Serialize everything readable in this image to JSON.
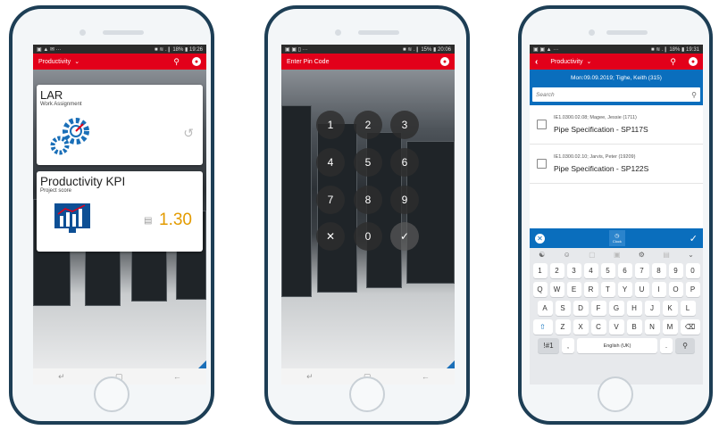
{
  "phone1": {
    "status_left": "▣ ▲ ✉ ···",
    "status_right": "■ ≋ .❙ 18% ▮ 19:26",
    "appbar_title": "Productivity",
    "tile_lar": {
      "title": "LAR",
      "subtitle": "Work Assignment"
    },
    "tile_kpi": {
      "title": "Productivity KPI",
      "subtitle": "Project score",
      "value": "1.30"
    }
  },
  "phone2": {
    "status_left": "▣ ▣ ▯ ···",
    "status_right": "■ ≋ .❙ 15% ▮ 20:06",
    "appbar_title": "Enter Pin Code",
    "keys": [
      "1",
      "2",
      "3",
      "4",
      "5",
      "6",
      "7",
      "8",
      "9",
      "✕",
      "0",
      "✓"
    ]
  },
  "phone3": {
    "status_left": "▣ ▣ ▲ ···",
    "status_right": "■ ≋ .❙ 18% ▮ 19:31",
    "appbar_title": "Productivity",
    "subheader": "Mon:09.09.2019; Tighe, Keith (315)",
    "search_placeholder": "Search",
    "items": [
      {
        "meta": "IE1.0300.02.08; Magee, Jessie (1711)",
        "title": "Pipe Specification - SP117S"
      },
      {
        "meta": "IE1.0300.02.10; Jarvis, Peter (19209)",
        "title": "Pipe Specification - SP122S"
      }
    ],
    "action_center": "Clock",
    "kb_row1": [
      "1",
      "2",
      "3",
      "4",
      "5",
      "6",
      "7",
      "8",
      "9",
      "0"
    ],
    "kb_row2": [
      "Q",
      "W",
      "E",
      "R",
      "T",
      "Y",
      "U",
      "I",
      "O",
      "P"
    ],
    "kb_row3": [
      "A",
      "S",
      "D",
      "F",
      "G",
      "H",
      "J",
      "K",
      "L"
    ],
    "kb_row4": [
      "Z",
      "X",
      "C",
      "V",
      "B",
      "N",
      "M"
    ],
    "kb_sym": "!#1",
    "kb_comma": ",",
    "kb_space": "English (UK)",
    "kb_period": "."
  },
  "colors": {
    "brand_red": "#e2001a",
    "brand_blue": "#0a6ebd",
    "kpi_orange": "#e39b00",
    "phone_frame": "#1d3e55"
  }
}
